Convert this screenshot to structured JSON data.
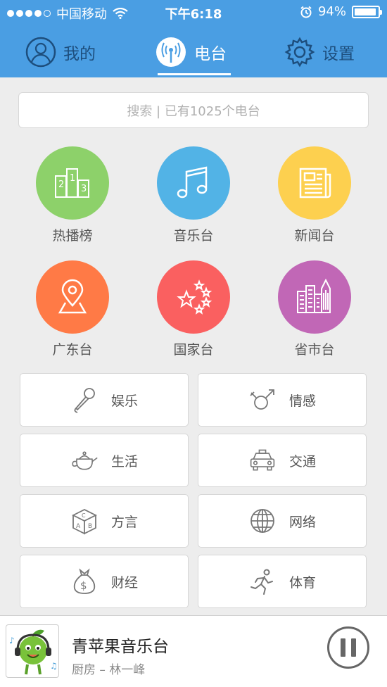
{
  "status": {
    "carrier": "中国移动",
    "time": "下午6:18",
    "battery": "94%",
    "battery_level": 0.94,
    "signal_bars": 4
  },
  "tabs": [
    {
      "label": "我的",
      "icon": "person-icon"
    },
    {
      "label": "电台",
      "icon": "radio-icon"
    },
    {
      "label": "设置",
      "icon": "gear-icon"
    }
  ],
  "search": {
    "placeholder": "搜索 | 已有1025个电台"
  },
  "categories": [
    {
      "label": "热播榜",
      "color": "#8dd16a",
      "icon": "ranking-podium-icon"
    },
    {
      "label": "音乐台",
      "color": "#52b3e6",
      "icon": "music-note-icon"
    },
    {
      "label": "新闻台",
      "color": "#fdd04f",
      "icon": "newspaper-icon"
    },
    {
      "label": "广东台",
      "color": "#ff7a46",
      "icon": "location-pin-icon"
    },
    {
      "label": "国家台",
      "color": "#fa6060",
      "icon": "stars-icon"
    },
    {
      "label": "省市台",
      "color": "#c167b6",
      "icon": "city-buildings-icon"
    }
  ],
  "tiles": [
    {
      "label": "娱乐",
      "icon": "microphone-icon"
    },
    {
      "label": "情感",
      "icon": "gender-symbols-icon"
    },
    {
      "label": "生活",
      "icon": "teapot-icon"
    },
    {
      "label": "交通",
      "icon": "taxi-icon"
    },
    {
      "label": "方言",
      "icon": "abc-cube-icon"
    },
    {
      "label": "网络",
      "icon": "globe-icon"
    },
    {
      "label": "财经",
      "icon": "money-bag-icon"
    },
    {
      "label": "体育",
      "icon": "runner-icon"
    }
  ],
  "player": {
    "station": "青苹果音乐台",
    "subtitle": "厨房 – 林一峰",
    "cover_icon": "green-apple-mascot-icon",
    "pause_icon": "pause-icon"
  },
  "colors": {
    "header": "#4a9ee3",
    "background": "#ededed"
  }
}
